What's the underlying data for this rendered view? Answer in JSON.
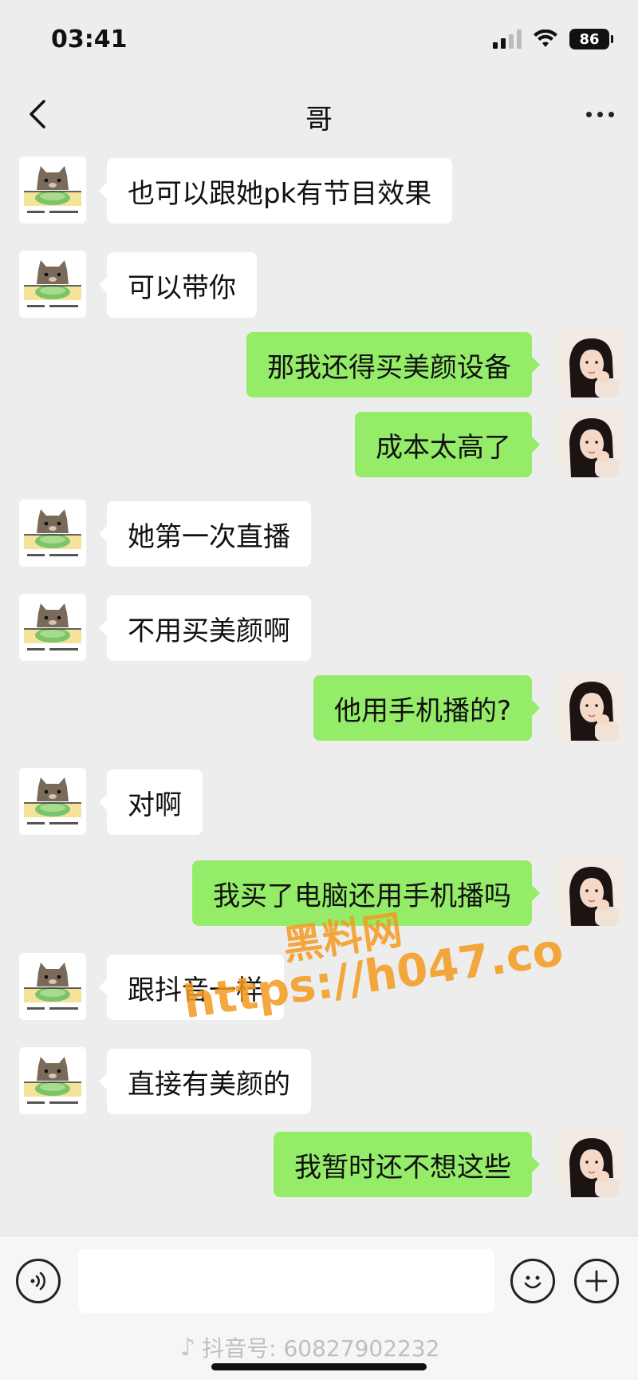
{
  "status_bar": {
    "time": "03:41",
    "battery": "86",
    "icons": [
      "signal-icon",
      "wifi-icon",
      "battery-icon"
    ]
  },
  "header": {
    "title": "哥",
    "back_icon": "chevron-left-icon",
    "more_icon": "more-dots-icon"
  },
  "messages": [
    {
      "side": "left",
      "avatar": "cat",
      "text": "也可以跟她pk有节目效果"
    },
    {
      "side": "left",
      "avatar": "cat",
      "text": "可以带你"
    },
    {
      "side": "right",
      "avatar": "girl",
      "text": "那我还得买美颜设备"
    },
    {
      "side": "right",
      "avatar": "girl",
      "text": "成本太高了"
    },
    {
      "side": "left",
      "avatar": "cat",
      "text": "她第一次直播"
    },
    {
      "side": "left",
      "avatar": "cat",
      "text": "不用买美颜啊"
    },
    {
      "side": "right",
      "avatar": "girl",
      "text": "他用手机播的?"
    },
    {
      "side": "left",
      "avatar": "cat",
      "text": "对啊"
    },
    {
      "side": "right",
      "avatar": "girl",
      "text": "我买了电脑还用手机播吗"
    },
    {
      "side": "left",
      "avatar": "cat",
      "text": "跟抖音一样"
    },
    {
      "side": "left",
      "avatar": "cat",
      "text": "直接有美颜的"
    },
    {
      "side": "right",
      "avatar": "girl",
      "text": "我暂时还不想这些"
    }
  ],
  "cat_avatar_caption": "我不要吃菜 我要吃麦当劳",
  "watermark": {
    "line1": "黑料网",
    "line2": "https://h047.co"
  },
  "input_bar": {
    "value": "",
    "voice_icon": "voice-icon",
    "emoji_icon": "emoji-icon",
    "plus_icon": "plus-icon"
  },
  "footer": {
    "douyin_text": "抖音号: 60827902232"
  },
  "colors": {
    "background": "#ededed",
    "bubble_right": "#95ec69",
    "bubble_left": "#ffffff",
    "watermark": "#f39a1e"
  }
}
